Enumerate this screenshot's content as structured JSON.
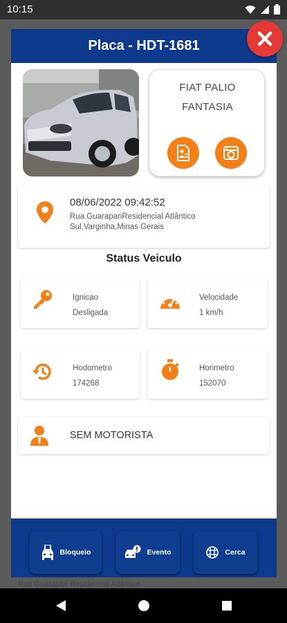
{
  "status_bar": {
    "time": "10:15"
  },
  "background": {
    "partial_text": "Rua Guarapari Residencial Atlântico"
  },
  "header": {
    "title": "Placa - HDT-1681"
  },
  "vehicle": {
    "model_line1": "FIAT PALIO",
    "model_line2": "FANTASIA"
  },
  "location": {
    "datetime": "08/06/2022 09:42:52",
    "address": "Rua GuarapariResidencial Atlântico Sul,Varginha,Minas Gerais"
  },
  "status": {
    "title": "Status Veiculo",
    "ignition": {
      "label": "Ignicao",
      "value": "Desligada"
    },
    "speed": {
      "label": "Velocidade",
      "value": "1 km/h"
    },
    "odometer": {
      "label": "Hodometro",
      "value": "174268"
    },
    "hourmeter": {
      "label": "Horimetro",
      "value": "152070"
    }
  },
  "driver": {
    "text": "SEM MOTORISTA"
  },
  "bottom_bar": {
    "block_label": "Bloqueio",
    "event_label": "Evento",
    "fence_label": "Cerca"
  },
  "colors": {
    "primary": "#0d3a8c",
    "accent": "#f57f17",
    "close": "#e53935"
  },
  "icons": [
    "wifi-icon",
    "signal-icon",
    "battery-icon",
    "close-icon",
    "document-icon",
    "camera-icon",
    "location-pin-icon",
    "key-icon",
    "speedometer-icon",
    "history-icon",
    "stopwatch-icon",
    "driver-icon",
    "block-car-icon",
    "event-car-icon",
    "fence-icon",
    "back-icon",
    "home-icon",
    "recents-icon"
  ]
}
